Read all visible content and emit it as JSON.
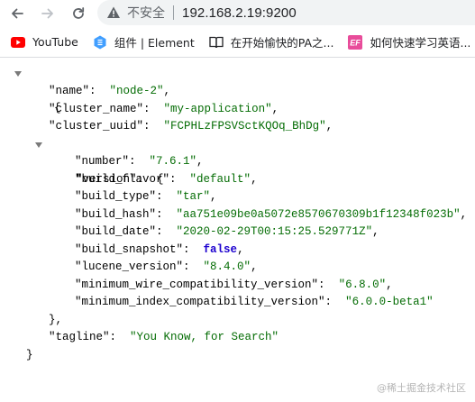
{
  "browser": {
    "insecure_label": "不安全",
    "url": "192.168.2.19:9200",
    "icons": {
      "back": "arrow-left-icon",
      "forward": "arrow-right-icon",
      "reload": "reload-icon",
      "security": "warning-triangle-icon"
    }
  },
  "bookmarks": [
    {
      "label": "YouTube",
      "icon": "youtube-icon"
    },
    {
      "label": "组件 | Element",
      "icon": "element-icon"
    },
    {
      "label": "在开始愉快的PA之...",
      "icon": "book-icon"
    },
    {
      "label": "如何快速学习英语...",
      "icon": "ef-icon",
      "badge": "EF"
    },
    {
      "label": "",
      "icon": "braces-icon"
    }
  ],
  "json": {
    "name_key": "\"name\"",
    "name_val": "\"node-2\"",
    "cluster_name_key": "\"cluster_name\"",
    "cluster_name_val": "\"my-application\"",
    "cluster_uuid_key": "\"cluster_uuid\"",
    "cluster_uuid_val": "\"FCPHLzFPSVSctKQOq_BhDg\"",
    "version_key": "\"version\"",
    "number_key": "\"number\"",
    "number_val": "\"7.6.1\"",
    "build_flavor_key": "\"build_flavor\"",
    "build_flavor_val": "\"default\"",
    "build_type_key": "\"build_type\"",
    "build_type_val": "\"tar\"",
    "build_hash_key": "\"build_hash\"",
    "build_hash_val": "\"aa751e09be0a5072e8570670309b1f12348f023b\"",
    "build_date_key": "\"build_date\"",
    "build_date_val": "\"2020-02-29T00:15:25.529771Z\"",
    "build_snapshot_key": "\"build_snapshot\"",
    "build_snapshot_val": "false",
    "lucene_version_key": "\"lucene_version\"",
    "lucene_version_val": "\"8.4.0\"",
    "min_wire_key": "\"minimum_wire_compatibility_version\"",
    "min_wire_val": "\"6.8.0\"",
    "min_index_key": "\"minimum_index_compatibility_version\"",
    "min_index_val": "\"6.0.0-beta1\"",
    "tagline_key": "\"tagline\"",
    "tagline_val": "\"You Know, for Search\""
  },
  "watermark": "@稀土掘金技术社区",
  "colors": {
    "string_value": "#046c04",
    "boolean_value": "#1c00cf",
    "omnibox_bg": "#f1f3f4"
  }
}
